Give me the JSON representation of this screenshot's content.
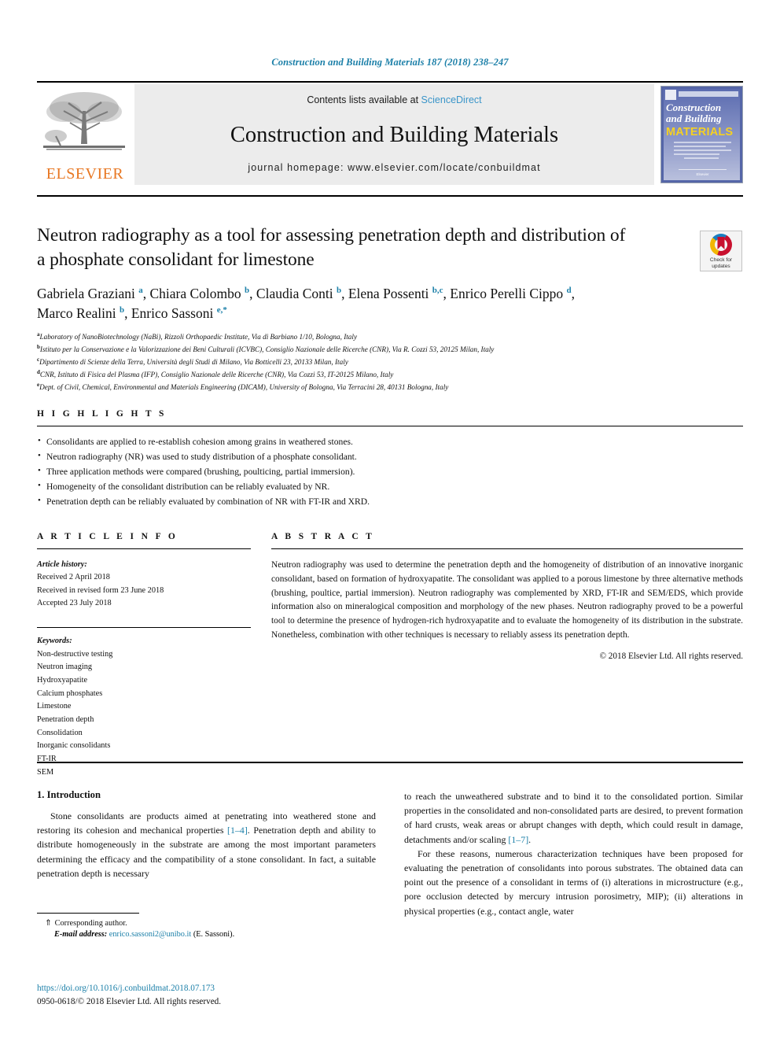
{
  "running_head": "Construction and Building Materials 187 (2018) 238–247",
  "masthead": {
    "publisher_name": "ELSEVIER",
    "contents_prefix": "Contents lists available at",
    "sciencedirect": "ScienceDirect",
    "journal_title": "Construction and Building Materials",
    "homepage": "journal homepage: www.elsevier.com/locate/conbuildmat",
    "cover": {
      "line1": "Construction",
      "line2": "and Building",
      "line3": "MATERIALS",
      "footer": "Elsevier"
    }
  },
  "article": {
    "title": "Neutron radiography as a tool for assessing penetration depth and distribution of a phosphate consolidant for limestone",
    "authors_line1_parts": [
      {
        "name": "Gabriela Graziani",
        "sup": "a",
        "sep": ", "
      },
      {
        "name": "Chiara Colombo",
        "sup": "b",
        "sep": ", "
      },
      {
        "name": "Claudia Conti",
        "sup": "b",
        "sep": ", "
      },
      {
        "name": "Elena Possenti",
        "sup": "b,c",
        "sep": ", "
      },
      {
        "name": "Enrico Perelli Cippo",
        "sup": "d",
        "sep": ","
      }
    ],
    "authors_line2_parts": [
      {
        "name": "Marco Realini",
        "sup": "b",
        "sep": ", "
      },
      {
        "name": "Enrico Sassoni",
        "sup": "e,*",
        "sep": ""
      }
    ],
    "affiliations": [
      {
        "marker": "a",
        "text": "Laboratory of NanoBiotechnology (NaBi), Rizzoli Orthopaedic Institute, Via di Barbiano 1/10, Bologna, Italy"
      },
      {
        "marker": "b",
        "text": "Istituto per la Conservazione e la Valorizzazione dei Beni Culturali (ICVBC), Consiglio Nazionale delle Ricerche (CNR), Via R. Cozzi 53, 20125 Milan, Italy"
      },
      {
        "marker": "c",
        "text": "Dipartimento di Scienze della Terra, Università degli Studi di Milano, Via Botticelli 23, 20133 Milan, Italy"
      },
      {
        "marker": "d",
        "text": "CNR, Istituto di Fisica del Plasma (IFP), Consiglio Nazionale delle Ricerche (CNR), Via Cozzi 53, IT-20125 Milano, Italy"
      },
      {
        "marker": "e",
        "text": "Dept. of Civil, Chemical, Environmental and Materials Engineering (DICAM), University of Bologna, Via Terracini 28, 40131 Bologna, Italy"
      }
    ]
  },
  "crossmark": {
    "line1": "Check for",
    "line2": "updates"
  },
  "highlights": {
    "label": "H I G H L I G H T S",
    "items": [
      "Consolidants are applied to re-establish cohesion among grains in weathered stones.",
      "Neutron radiography (NR) was used to study distribution of a phosphate consolidant.",
      "Three application methods were compared (brushing, poulticing, partial immersion).",
      "Homogeneity of the consolidant distribution can be reliably evaluated by NR.",
      "Penetration depth can be reliably evaluated by combination of NR with FT-IR and XRD."
    ]
  },
  "article_info": {
    "label": "A R T I C L E   I N F O",
    "history_title": "Article history:",
    "history": [
      "Received 2 April 2018",
      "Received in revised form 23 June 2018",
      "Accepted 23 July 2018"
    ],
    "keywords_title": "Keywords:",
    "keywords": [
      "Non-destructive testing",
      "Neutron imaging",
      "Hydroxyapatite",
      "Calcium phosphates",
      "Limestone",
      "Penetration depth",
      "Consolidation",
      "Inorganic consolidants",
      "FT-IR",
      "SEM"
    ]
  },
  "abstract": {
    "label": "A B S T R A C T",
    "text": "Neutron radiography was used to determine the penetration depth and the homogeneity of distribution of an innovative inorganic consolidant, based on formation of hydroxyapatite. The consolidant was applied to a porous limestone by three alternative methods (brushing, poultice, partial immersion). Neutron radiography was complemented by XRD, FT-IR and SEM/EDS, which provide information also on mineralogical composition and morphology of the new phases. Neutron radiography proved to be a powerful tool to determine the presence of hydrogen-rich hydroxyapatite and to evaluate the homogeneity of its distribution in the substrate. Nonetheless, combination with other techniques is necessary to reliably assess its penetration depth.",
    "copyright": "© 2018 Elsevier Ltd. All rights reserved."
  },
  "body": {
    "section_heading": "1. Introduction",
    "left_paragraph_pre": "Stone consolidants are products aimed at penetrating into weathered stone and restoring its cohesion and mechanical properties ",
    "left_citation": "[1–4]",
    "left_paragraph_post": ". Penetration depth and ability to distribute homogeneously in the substrate are among the most important parameters determining the efficacy and the compatibility of a stone consolidant. In fact, a suitable penetration depth is necessary",
    "right_paragraph1_pre": "to reach the unweathered substrate and to bind it to the consolidated portion. Similar properties in the consolidated and non-consolidated parts are desired, to prevent formation of hard crusts, weak areas or abrupt changes with depth, which could result in damage, detachments and/or scaling ",
    "right_citation": "[1–7]",
    "right_paragraph1_post": ".",
    "right_paragraph2": "For these reasons, numerous characterization techniques have been proposed for evaluating the penetration of consolidants into porous substrates. The obtained data can point out the presence of a consolidant in terms of (i) alterations in microstructure (e.g., pore occlusion detected by mercury intrusion porosimetry, MIP); (ii) alterations in physical properties (e.g., contact angle, water"
  },
  "footnote": {
    "star": "⇑",
    "corresponding": "Corresponding author.",
    "email_label": "E-mail address:",
    "email": "enrico.sassoni2@unibo.it",
    "email_owner": "(E. Sassoni)."
  },
  "footer": {
    "doi": "https://doi.org/10.1016/j.conbuildmat.2018.07.173",
    "issn": "0950-0618/© 2018 Elsevier Ltd. All rights reserved."
  },
  "colors": {
    "link_blue": "#1b7fa8",
    "sciencedirect_blue": "#3a95c9",
    "elsevier_orange": "#e87722"
  }
}
